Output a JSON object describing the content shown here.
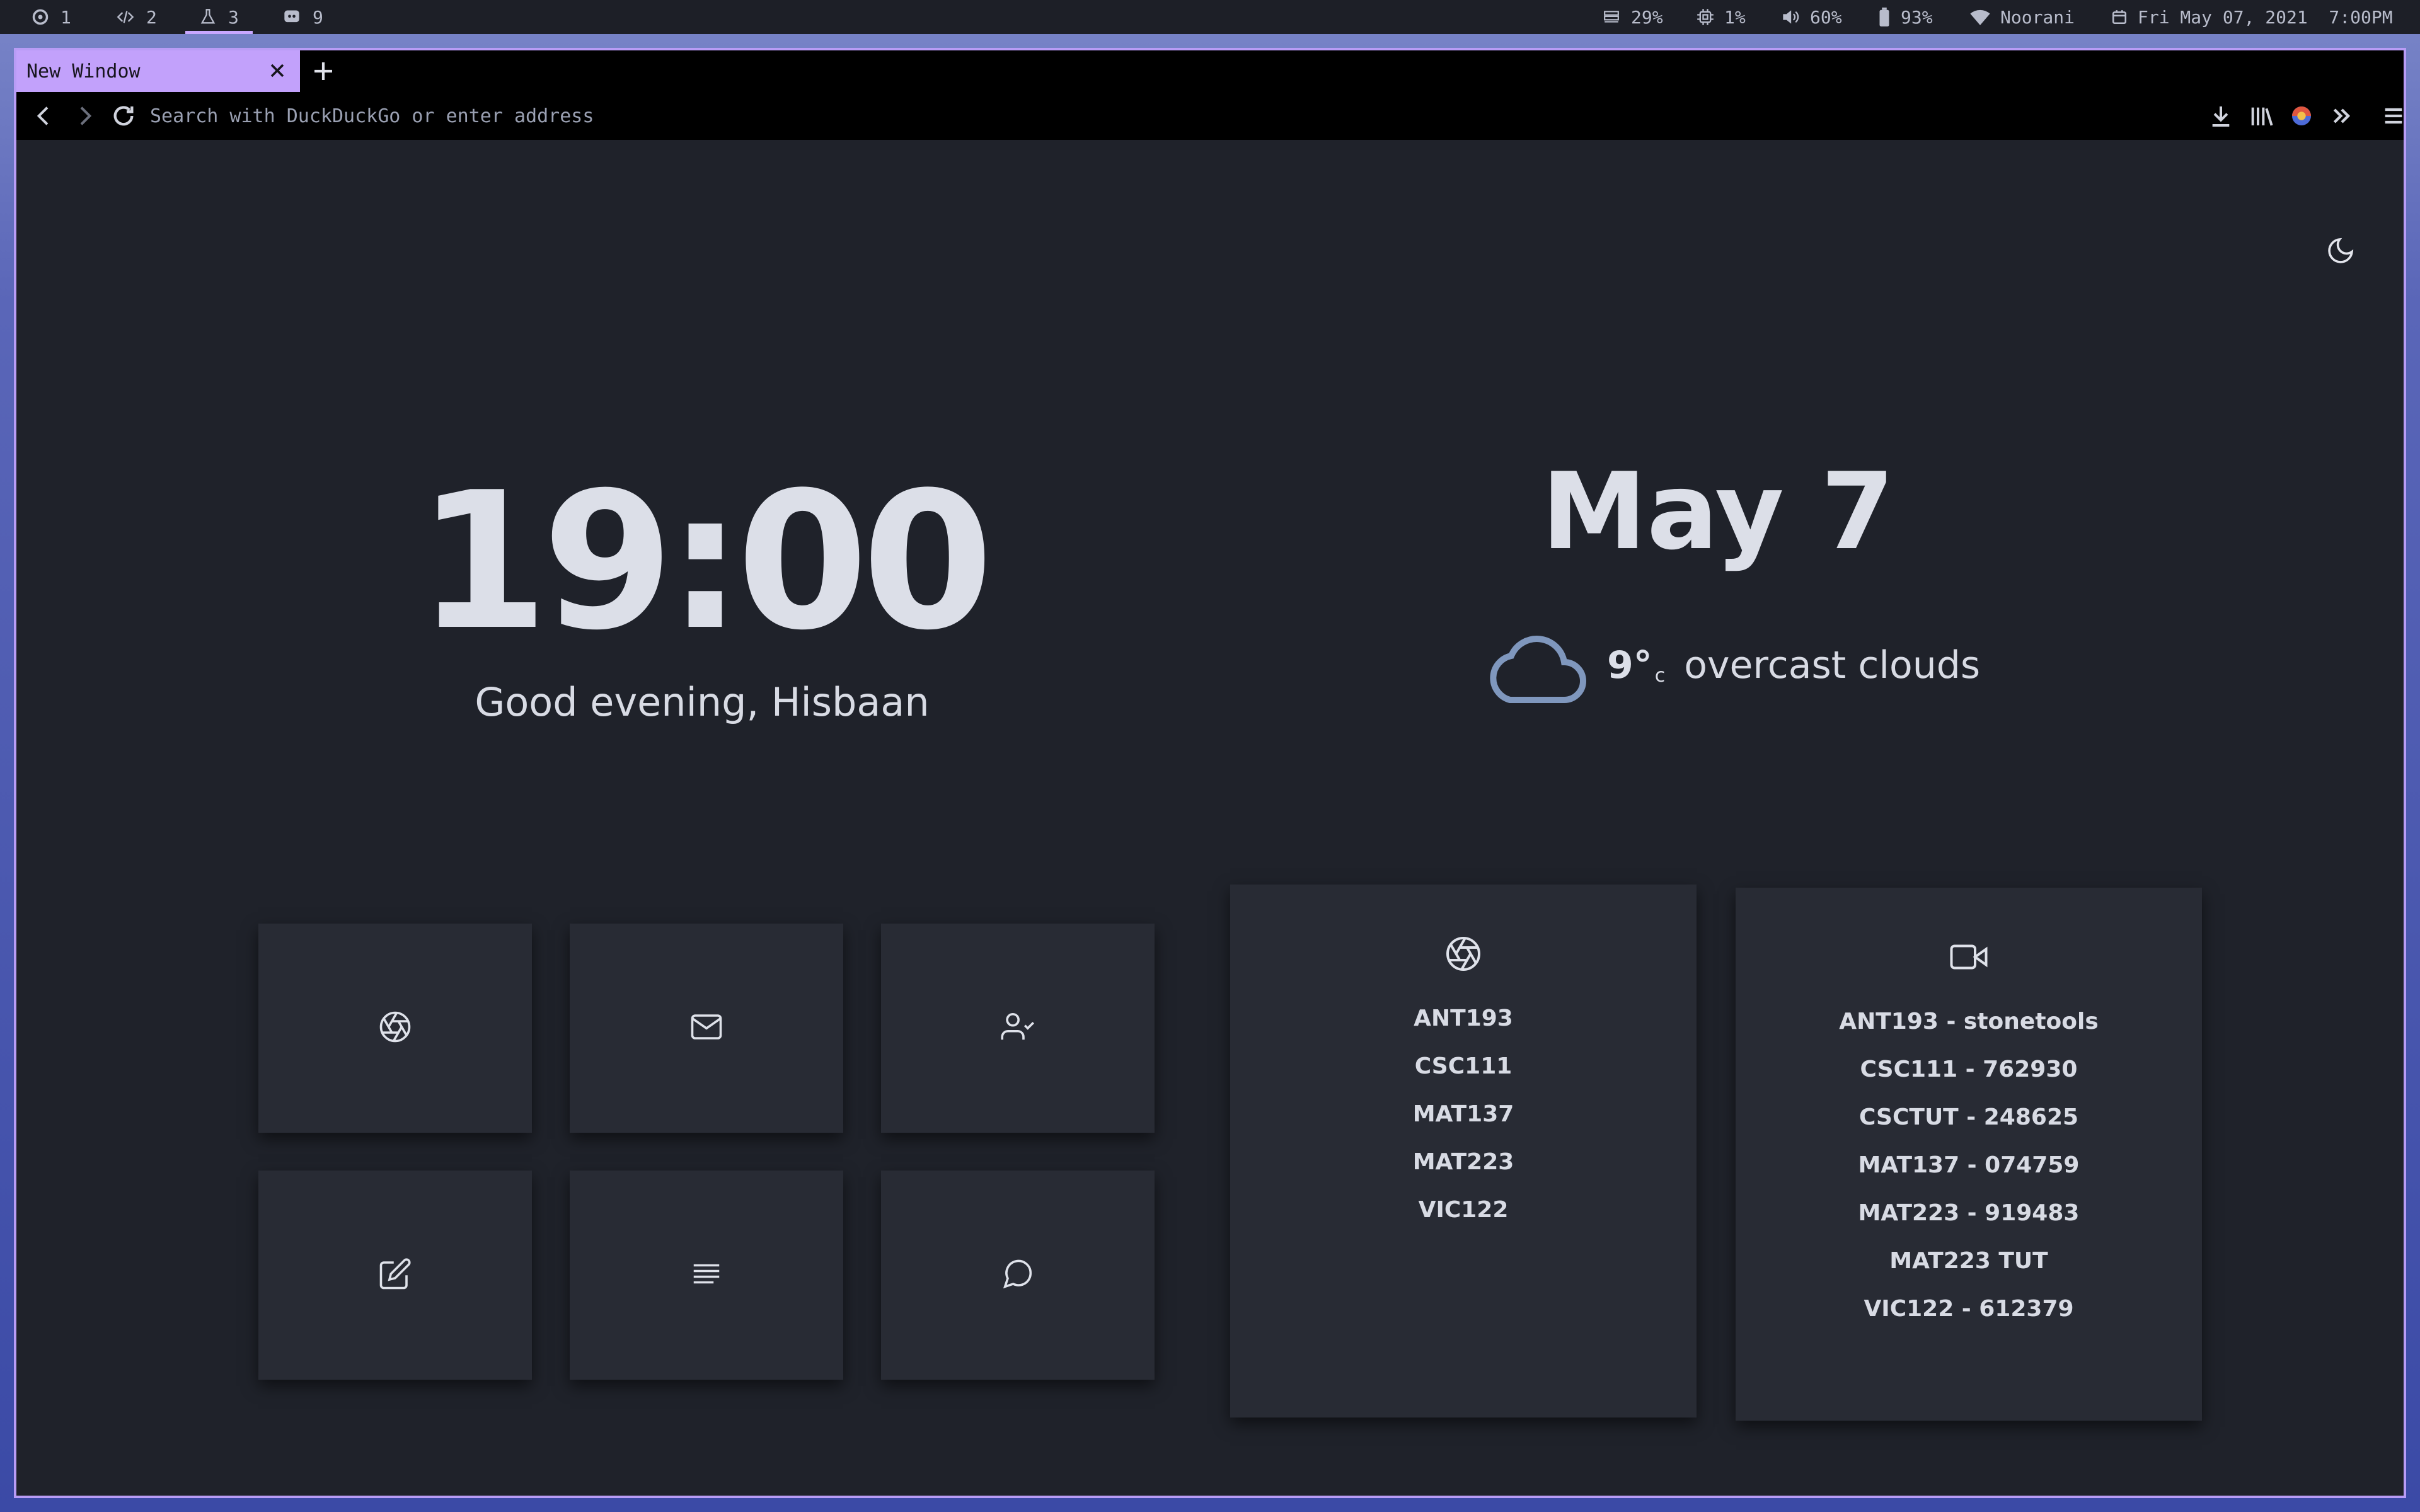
{
  "topbar": {
    "workspaces": [
      {
        "icon": "firefox-icon",
        "label": "1"
      },
      {
        "icon": "code-icon",
        "label": "2"
      },
      {
        "icon": "flask-icon",
        "label": "3"
      },
      {
        "icon": "discord-icon",
        "label": "9"
      }
    ],
    "active_workspace": "3",
    "status": {
      "memory": "29%",
      "cpu": "1%",
      "volume": "60%",
      "battery": "93%",
      "wifi": "Noorani",
      "datetime": "Fri May 07, 2021  7:00PM"
    }
  },
  "browser": {
    "tab_title": "New Window",
    "address_placeholder": "Search with DuckDuckGo or enter address",
    "accent": "#c2a1fb"
  },
  "page": {
    "clock": "19:00",
    "greeting": "Good evening, Hisbaan",
    "date": "May 7",
    "weather": {
      "icon": "cloud-icon",
      "temp": "9°",
      "unit": "c",
      "description": "overcast clouds"
    },
    "tiles": [
      {
        "icon": "aperture-icon"
      },
      {
        "icon": "mail-icon"
      },
      {
        "icon": "user-check-icon"
      },
      {
        "icon": "edit-icon"
      },
      {
        "icon": "align-left-icon"
      },
      {
        "icon": "message-circle-icon"
      }
    ],
    "courses": {
      "icon": "aperture-icon",
      "items": [
        "ANT193",
        "CSC111",
        "MAT137",
        "MAT223",
        "VIC122"
      ]
    },
    "meetings": {
      "icon": "video-icon",
      "items": [
        "ANT193 - stonetools",
        "CSC111 - 762930",
        "CSCTUT - 248625",
        "MAT137 - 074759",
        "MAT223 - 919483",
        "MAT223 TUT",
        "VIC122 - 612379"
      ]
    }
  }
}
